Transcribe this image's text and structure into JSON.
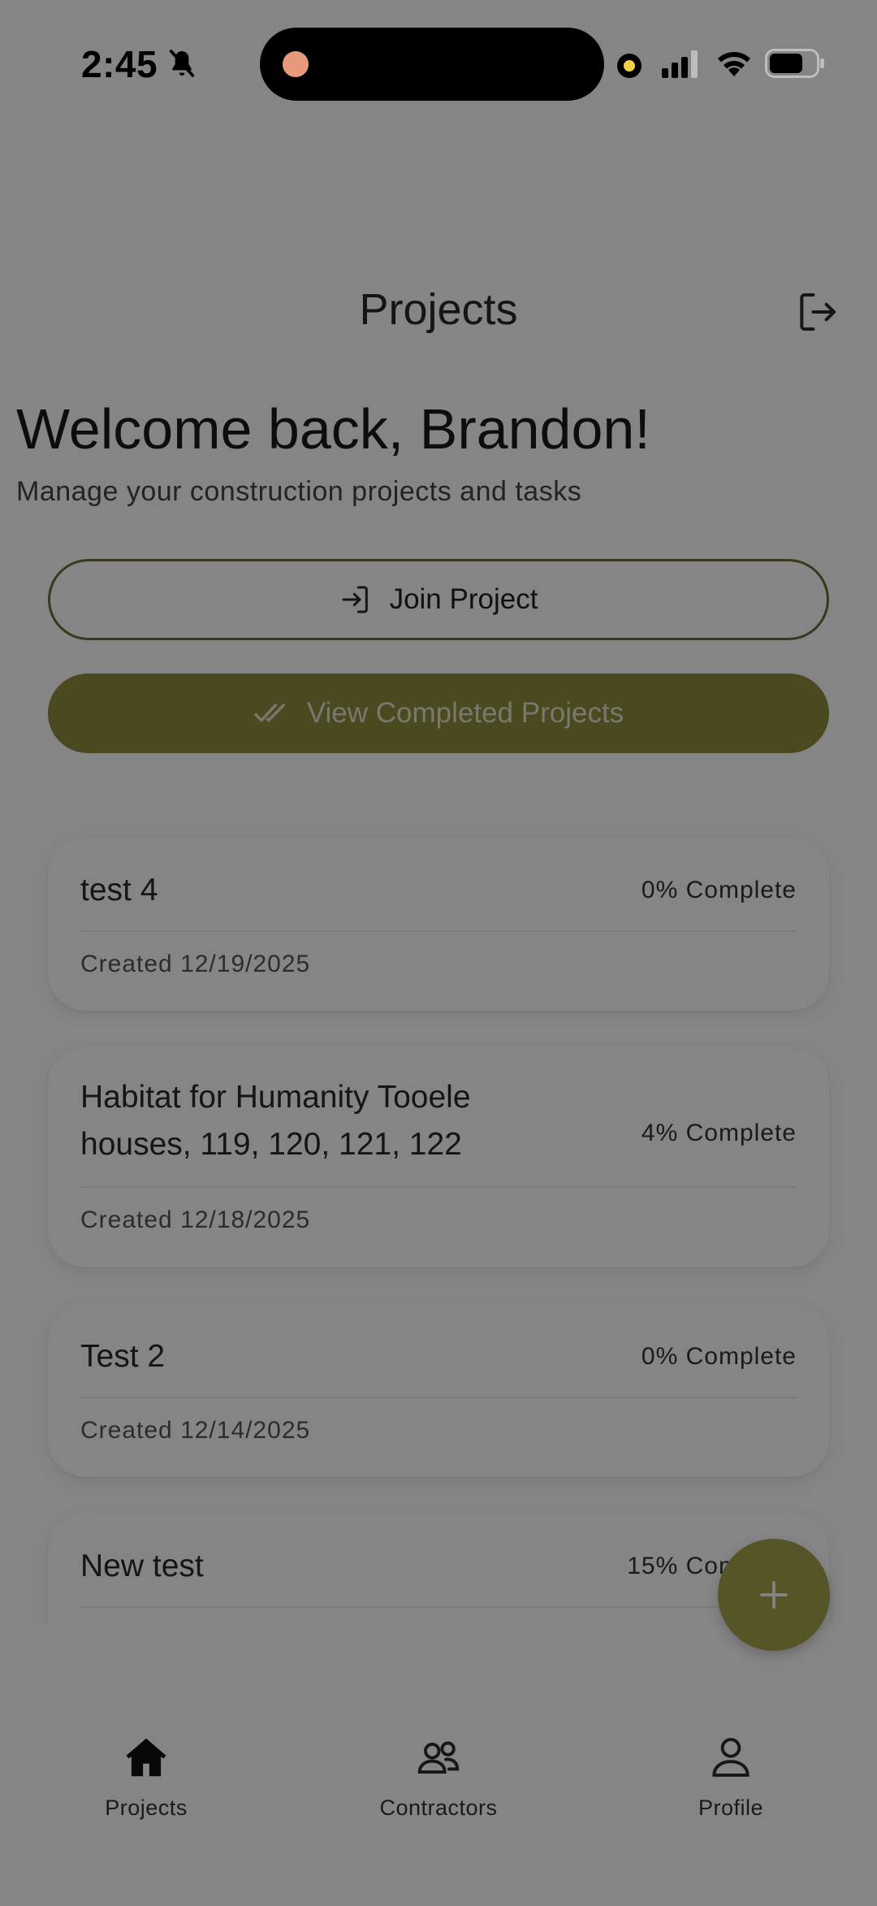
{
  "status_bar": {
    "time": "2:45",
    "icons": [
      "bell-slash-icon",
      "recording-indicator-icon",
      "signal-icon",
      "wifi-icon",
      "battery-icon"
    ]
  },
  "header": {
    "title": "Projects",
    "logout_icon": "logout-icon"
  },
  "welcome": {
    "title": "Welcome back, Brandon!",
    "subtitle": "Manage your construction projects and tasks"
  },
  "actions": {
    "join_label": "Join Project",
    "join_icon": "login-arrow-icon",
    "completed_label": "View Completed Projects",
    "completed_icon": "double-check-icon"
  },
  "projects": [
    {
      "name": "test 4",
      "progress": "0% Complete",
      "created": "Created 12/19/2025"
    },
    {
      "name": "Habitat for Humanity Tooele houses, 119, 120, 121, 122",
      "progress": "4% Complete",
      "created": "Created 12/18/2025"
    },
    {
      "name": "Test 2",
      "progress": "0% Complete",
      "created": "Created 12/14/2025"
    },
    {
      "name": "New test",
      "progress": "15% Complete",
      "created": ""
    }
  ],
  "fab": {
    "icon": "plus-icon"
  },
  "bottom_nav": {
    "items": [
      {
        "label": "Projects",
        "icon": "home-icon",
        "active": true
      },
      {
        "label": "Contractors",
        "icon": "users-icon",
        "active": false
      },
      {
        "label": "Profile",
        "icon": "user-icon",
        "active": false
      }
    ]
  },
  "colors": {
    "accent": "#8f8c3e",
    "fab": "#a6a34c",
    "outline": "#6e6a3a",
    "dim_overlay": "rgba(0,0,0,0.48)"
  }
}
